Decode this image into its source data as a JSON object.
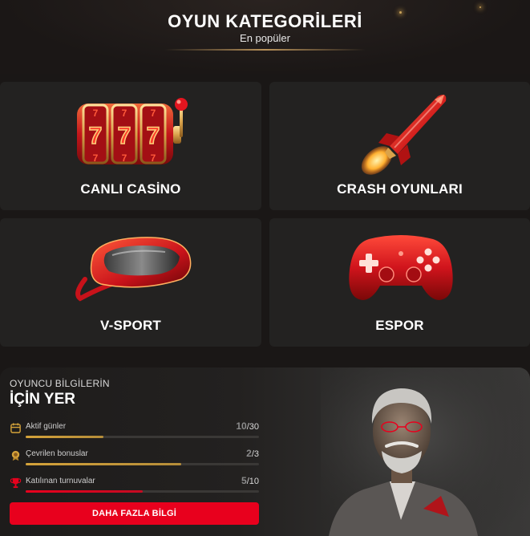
{
  "header": {
    "title": "OYUN KATEGORİLERİ",
    "subtitle": "En popüler"
  },
  "categories": [
    {
      "label": "CANLI CASİNO",
      "icon": "slot-machine-icon"
    },
    {
      "label": "CRASH OYUNLARI",
      "icon": "rocket-icon"
    },
    {
      "label": "V-SPORT",
      "icon": "vr-headset-icon"
    },
    {
      "label": "ESPOR",
      "icon": "gamepad-icon"
    }
  ],
  "player": {
    "kicker": "OYUNCU BİLGİLERİN",
    "heading": "İÇİN YER",
    "stats": [
      {
        "label": "Aktif günler",
        "current": "10",
        "total": "/30",
        "progress": 0.333,
        "icon": "calendar-icon",
        "color": "#d4a23a"
      },
      {
        "label": "Çevrilen bonuslar",
        "current": "2",
        "total": "/3",
        "progress": 0.667,
        "icon": "medal-icon",
        "color": "#d4a23a"
      },
      {
        "label": "Katılınan turnuvalar",
        "current": "5",
        "total": "/10",
        "progress": 0.5,
        "icon": "trophy-icon",
        "color": "#e8001d"
      }
    ],
    "cta_label": "DAHA FAZLA BİLGİ"
  },
  "colors": {
    "accent": "#e8001d",
    "gold": "#d4a23a",
    "card_bg": "#232221"
  }
}
